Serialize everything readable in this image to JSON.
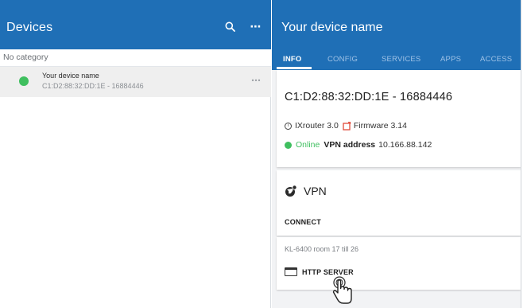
{
  "left_panel": {
    "title": "Devices",
    "search_icon": "search-icon",
    "more_icon": "more-horizontal-icon",
    "more_glyph": "⋯",
    "category_label": "No category",
    "device": {
      "name": "Your device name",
      "id": "C1:D2:88:32:DD:1E - 16884446",
      "status_color": "#3fbf5f",
      "more_glyph": "⋯"
    }
  },
  "right_panel": {
    "title": "Your device name",
    "tabs": [
      {
        "label": "INFO",
        "active": true
      },
      {
        "label": "CONFIG",
        "active": false
      },
      {
        "label": "SERVICES",
        "active": false
      },
      {
        "label": "APPS",
        "active": false
      },
      {
        "label": "ACCESS",
        "active": false
      }
    ],
    "info_card": {
      "device_id": "C1:D2:88:32:DD:1E - 16884446",
      "model": "IXrouter 3.0",
      "firmware": "Firmware 3.14",
      "status": "Online",
      "vpn_address_label": "VPN address",
      "vpn_address": "10.166.88.142"
    },
    "vpn_card": {
      "title": "VPN",
      "icon": "vpn-globe-icon",
      "connect_label": "CONNECT"
    },
    "service_card": {
      "location": "KL-6400 room 17 till 26",
      "http_label": "HTTP SERVER",
      "icon": "window-icon"
    }
  },
  "colors": {
    "header_blue": "#1f6fb6",
    "online_green": "#3fbf5f",
    "firmware_red": "#e04b3a",
    "selected_row": "#efefef"
  }
}
